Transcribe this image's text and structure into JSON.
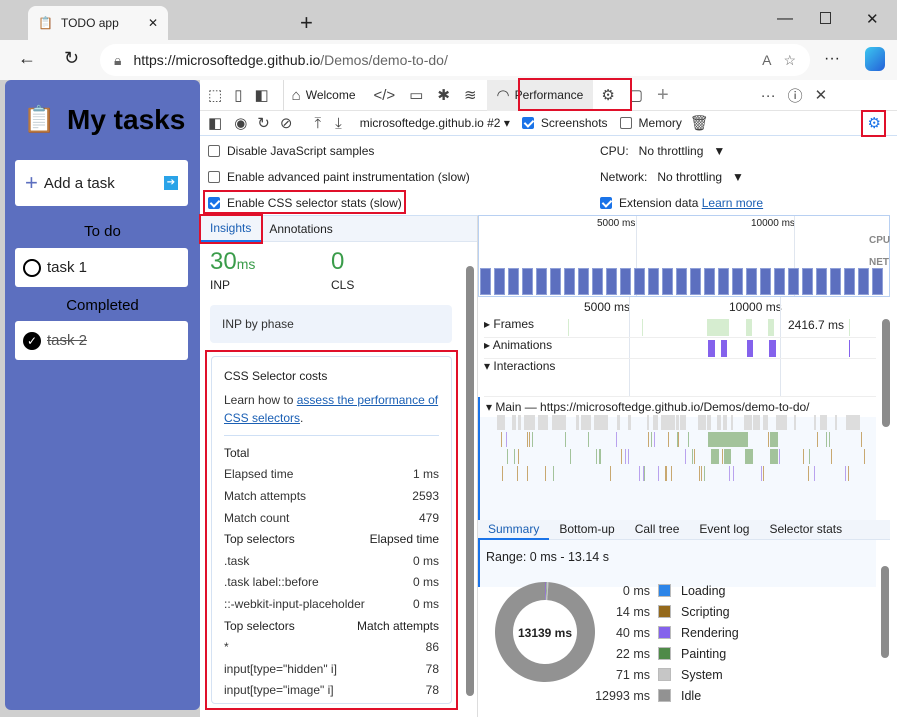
{
  "browser": {
    "tab_title": "TODO app",
    "url_host": "https://microsoftedge.github.io",
    "url_path": "/Demos/demo-to-do/"
  },
  "app": {
    "title": "My tasks",
    "add_label": "Add a task",
    "todo_heading": "To do",
    "completed_heading": "Completed",
    "todo": [
      {
        "label": "task 1",
        "done": false
      }
    ],
    "completed": [
      {
        "label": "task 2",
        "done": true
      }
    ]
  },
  "devtools": {
    "tabs": [
      {
        "label": "Welcome"
      },
      {
        "label": "Performance",
        "active": true
      }
    ],
    "toolbar": {
      "target": "microsoftedge.github.io #2",
      "screenshots_label": "Screenshots",
      "screenshots": true,
      "memory_label": "Memory",
      "memory": false
    },
    "settings": {
      "disable_js": "Disable JavaScript samples",
      "adv_paint": "Enable advanced paint instrumentation (slow)",
      "css_stats": "Enable CSS selector stats (slow)",
      "cpu_label": "CPU:",
      "cpu_value": "No throttling",
      "net_label": "Network:",
      "net_value": "No throttling",
      "ext_label": "Extension data",
      "learn_more": "Learn more"
    },
    "side_tabs": [
      "Insights",
      "Annotations"
    ],
    "metrics": {
      "inp_value": "30",
      "inp_unit": "ms",
      "inp_label": "INP",
      "cls_value": "0",
      "cls_label": "CLS"
    },
    "inp_phase": "INP by phase",
    "css_costs": {
      "title": "CSS Selector costs",
      "learn_pre": "Learn how to ",
      "learn_link": "assess the performance of CSS selectors",
      "learn_post": ".",
      "total_label": "Total",
      "totals": [
        {
          "k": "Elapsed time",
          "v": "1 ms"
        },
        {
          "k": "Match attempts",
          "v": "2593"
        },
        {
          "k": "Match count",
          "v": "479"
        }
      ],
      "elapsed_header": {
        "k": "Top selectors",
        "v": "Elapsed time"
      },
      "elapsed": [
        {
          "k": ".task",
          "v": "0 ms"
        },
        {
          "k": ".task label::before",
          "v": "0 ms"
        },
        {
          "k": "::-webkit-input-placeholder",
          "v": "0 ms"
        }
      ],
      "attempts_header": {
        "k": "Top selectors",
        "v": "Match attempts"
      },
      "attempts": [
        {
          "k": "*",
          "v": "86"
        },
        {
          "k": "input[type=\"hidden\" i]",
          "v": "78"
        },
        {
          "k": "input[type=\"image\" i]",
          "v": "78"
        }
      ]
    },
    "overview": {
      "tick1": "5000 ms",
      "tick2": "10000 ms",
      "cpu": "CPU",
      "net": "NET"
    },
    "tracks": {
      "tick1": "5000 ms",
      "tick2": "10000 ms",
      "frames": "Frames",
      "frame_time": "2416.7 ms",
      "animations": "Animations",
      "interactions": "Interactions",
      "main": "Main — https://microsoftedge.github.io/Demos/demo-to-do/"
    },
    "bottom_tabs": [
      "Summary",
      "Bottom-up",
      "Call tree",
      "Event log",
      "Selector stats"
    ],
    "summary": {
      "range": "Range: 0 ms - 13.14 s",
      "total": "13139 ms",
      "items": [
        {
          "v": "0 ms",
          "label": "Loading",
          "color": "#2d85e8",
          "ms": 0
        },
        {
          "v": "14 ms",
          "label": "Scripting",
          "color": "#94691c",
          "ms": 14
        },
        {
          "v": "40 ms",
          "label": "Rendering",
          "color": "#8462ec",
          "ms": 40
        },
        {
          "v": "22 ms",
          "label": "Painting",
          "color": "#4f8a48",
          "ms": 22
        },
        {
          "v": "71 ms",
          "label": "System",
          "color": "#c6c6c6",
          "ms": 71
        },
        {
          "v": "12993 ms",
          "label": "Idle",
          "color": "#929292",
          "ms": 12993
        }
      ]
    }
  }
}
